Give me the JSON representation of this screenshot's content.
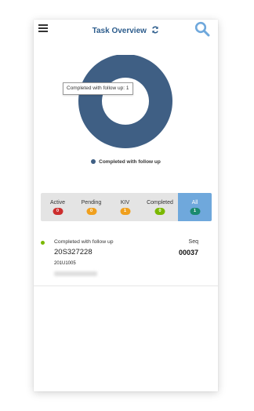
{
  "header": {
    "title": "Task Overview"
  },
  "icons": {
    "menu": "menu-icon",
    "refresh": "refresh-icon",
    "search": "search-icon"
  },
  "colors": {
    "title": "#2c5c8c",
    "donut": "#3f5f84",
    "search": "#6fa8dc",
    "active": "#cc2e2e",
    "pending": "#f0a01e",
    "kiv": "#f0a01e",
    "completed": "#7ab800",
    "all": "#1a8a6e",
    "tab_selected": "#6fa8dc"
  },
  "chart_data": {
    "type": "pie",
    "donut": true,
    "slices": [
      {
        "label": "Completed with follow up",
        "value": 1
      }
    ],
    "legend": [
      "Completed with follow up"
    ],
    "legend_position": "bottom",
    "tooltip": "Completed with follow up: 1"
  },
  "tabs": [
    {
      "label": "Active",
      "count": "0"
    },
    {
      "label": "Pending",
      "count": "0"
    },
    {
      "label": "KIV",
      "count": "1"
    },
    {
      "label": "Completed",
      "count": "0"
    },
    {
      "label": "All",
      "count": "1",
      "selected": true
    }
  ],
  "task": {
    "status": "Completed with follow up",
    "code": "20S327228",
    "sub_code": "201U1005",
    "seq_label": "Seq",
    "seq_value": "00037"
  }
}
